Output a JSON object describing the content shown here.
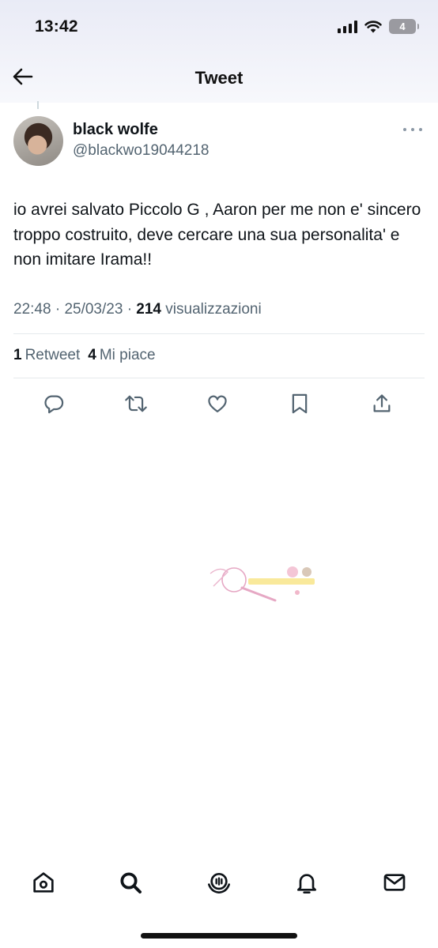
{
  "status_bar": {
    "time": "13:42",
    "battery": "4",
    "icons": [
      "signal-icon",
      "wifi-icon",
      "battery-icon"
    ]
  },
  "header": {
    "back_icon": "back-arrow-icon",
    "title": "Tweet"
  },
  "tweet": {
    "author": {
      "display_name": "black wolfe",
      "handle": "@blackwo19044218"
    },
    "text": "io avrei salvato Piccolo G , Aaron per me non e' sincero troppo costruito, deve cercare una sua personalita' e non imitare Irama!!",
    "time": "22:48",
    "date": "25/03/23",
    "separator": "·",
    "views_count": "214",
    "views_label": "visualizzazioni",
    "retweets_count": "1",
    "retweets_label": "Retweet",
    "likes_count": "4",
    "likes_label": "Mi piace"
  },
  "actions": [
    "reply-icon",
    "retweet-icon",
    "like-icon",
    "bookmark-icon",
    "share-icon"
  ],
  "bottom_nav": [
    "home-icon",
    "search-icon",
    "spaces-icon",
    "notifications-icon",
    "messages-icon"
  ],
  "colors": {
    "text_primary": "#0f1419",
    "text_secondary": "#536471",
    "divider": "#e5e9ec",
    "header_bg": "#eceef7"
  }
}
